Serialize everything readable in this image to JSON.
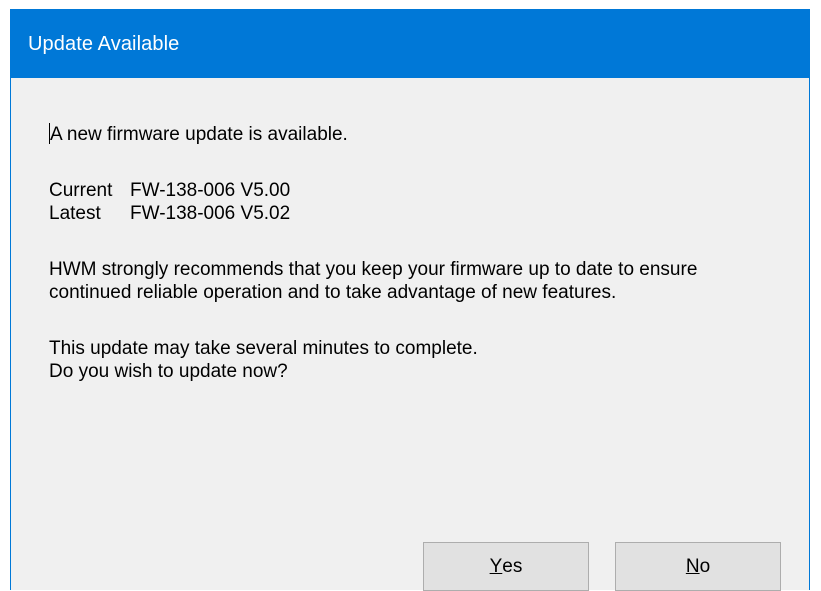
{
  "window": {
    "title": "Update Available"
  },
  "message": {
    "intro": "A new firmware update is available.",
    "current_label": "Current",
    "current_value": "FW-138-006 V5.00",
    "latest_label": "Latest",
    "latest_value": "FW-138-006 V5.02",
    "recommend_text": "HWM strongly recommends that you keep your firmware up to date to ensure continued reliable operation and to take advantage of new features.",
    "duration_text": "This update may take several minutes to complete.",
    "question_text": "Do you wish to update now?"
  },
  "buttons": {
    "yes_mnemonic": "Y",
    "yes_rest": "es",
    "no_mnemonic": "N",
    "no_rest": "o"
  },
  "colors": {
    "titlebar": "#0078d7",
    "dialog_background": "#f0f0f0",
    "button_background": "#e1e1e1",
    "button_border": "#adadad"
  }
}
